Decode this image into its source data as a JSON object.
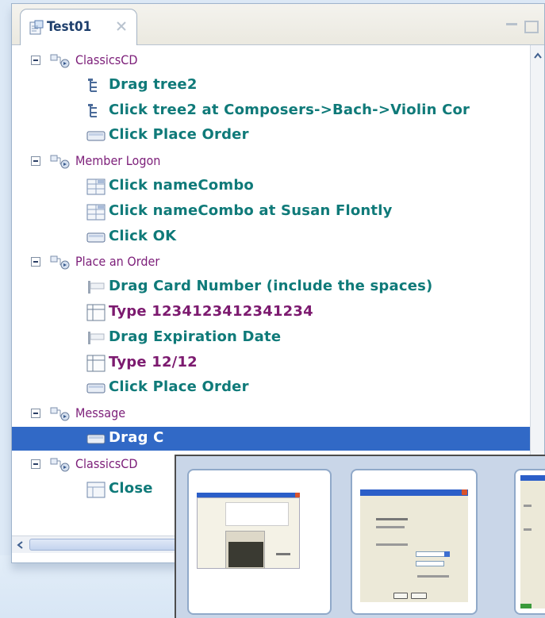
{
  "tab": {
    "title": "Test01",
    "icon": "test-script-icon",
    "close_icon": "close-icon"
  },
  "tree": [
    {
      "kind": "group",
      "label": "ClassicsCD",
      "icon": "group-icon"
    },
    {
      "kind": "action",
      "label": "Drag tree2",
      "icon": "tree-icon"
    },
    {
      "kind": "action",
      "label": "Click tree2 at Composers->Bach->Violin Cor",
      "icon": "tree-icon"
    },
    {
      "kind": "action",
      "label": "Click Place Order",
      "icon": "button-icon"
    },
    {
      "kind": "group",
      "label": "Member Logon",
      "icon": "group-icon"
    },
    {
      "kind": "action",
      "label": "Click nameCombo",
      "icon": "combo-icon"
    },
    {
      "kind": "action",
      "label": "Click nameCombo at Susan Flontly",
      "icon": "combo-icon"
    },
    {
      "kind": "action",
      "label": "Click OK",
      "icon": "button-icon"
    },
    {
      "kind": "group",
      "label": "Place an Order",
      "icon": "group-icon"
    },
    {
      "kind": "action",
      "label": "Drag Card Number (include the spaces)",
      "icon": "label-icon"
    },
    {
      "kind": "type",
      "label": "Type 1234123412341234",
      "icon": "textfield-icon"
    },
    {
      "kind": "action",
      "label": "Drag Expiration Date",
      "icon": "label-icon"
    },
    {
      "kind": "type",
      "label": "Type 12/12",
      "icon": "textfield-icon"
    },
    {
      "kind": "action",
      "label": "Click Place Order",
      "icon": "button-icon"
    },
    {
      "kind": "group",
      "label": "Message",
      "icon": "group-icon"
    },
    {
      "kind": "action",
      "label": "Drag C",
      "icon": "button-icon",
      "selected": true
    },
    {
      "kind": "group",
      "label": "ClassicsCD",
      "icon": "group-icon"
    },
    {
      "kind": "action",
      "label": "Close",
      "icon": "window-icon"
    }
  ],
  "colors": {
    "group_text": "#7c1e79",
    "action_text": "#0f7a79",
    "type_text": "#7c1a6f",
    "selection": "#3169c6"
  }
}
